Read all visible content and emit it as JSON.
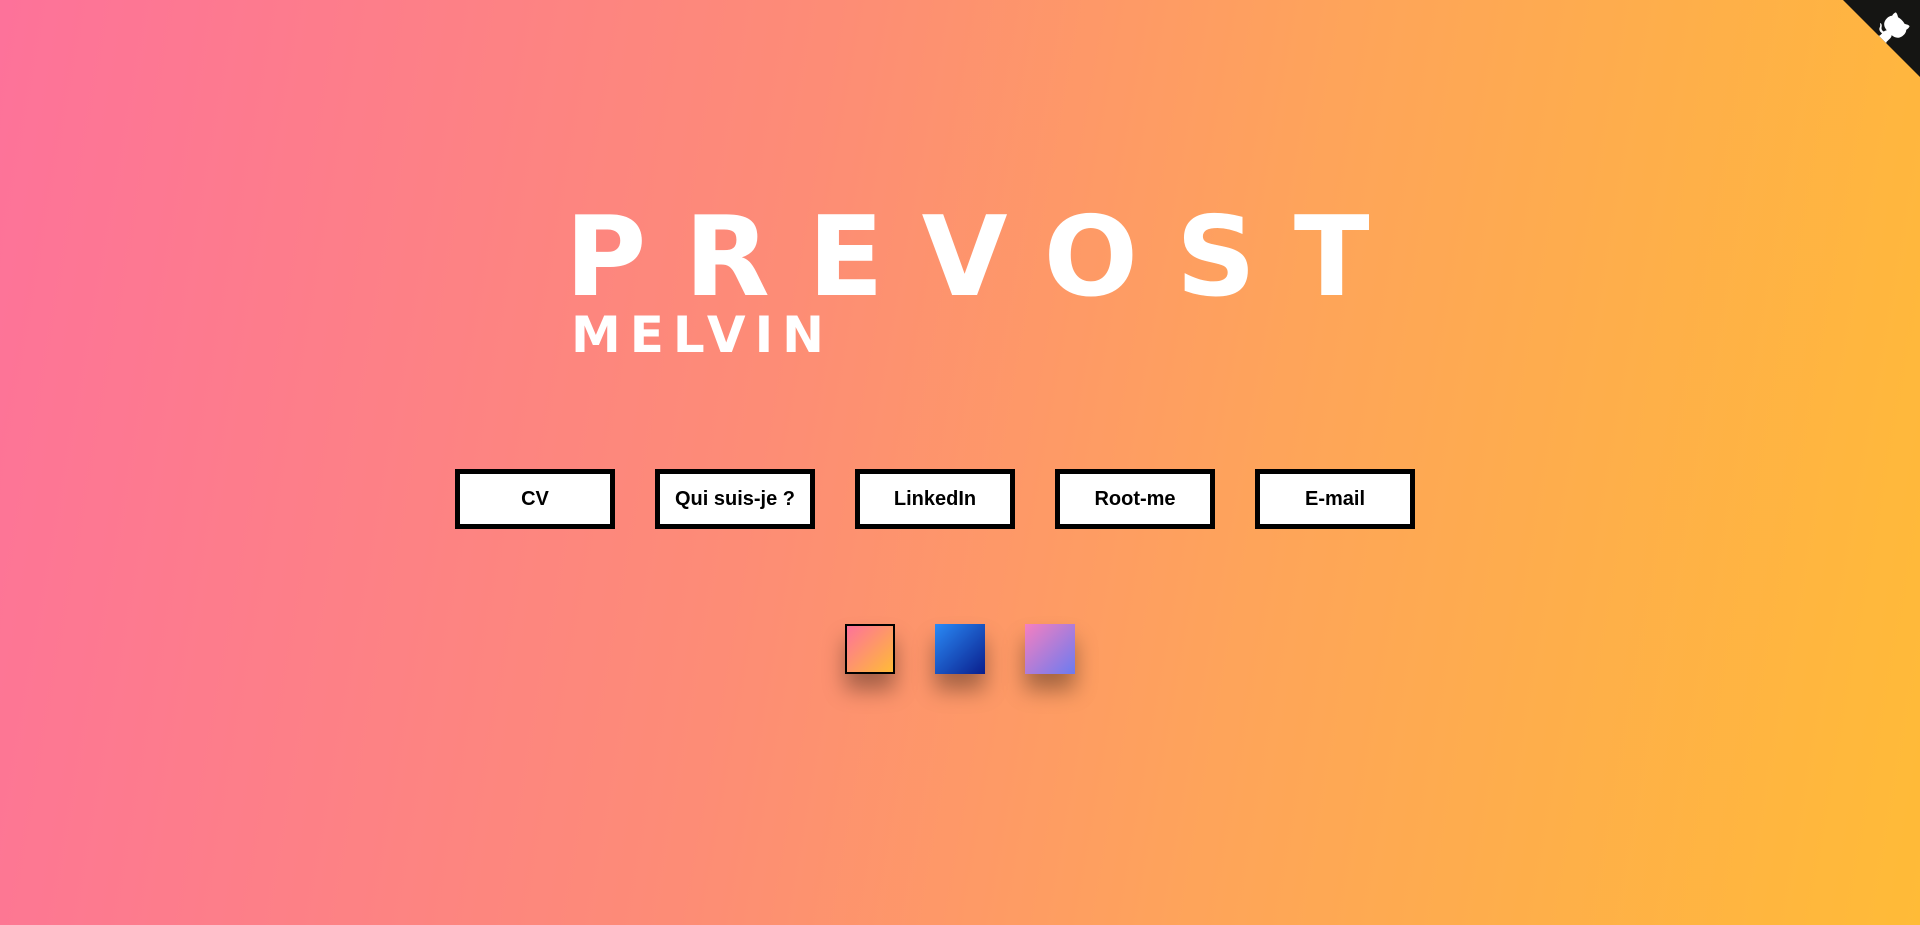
{
  "header": {
    "last_name": "PREVOST",
    "first_name": "MELVIN"
  },
  "nav": {
    "buttons": [
      {
        "label": "CV"
      },
      {
        "label": "Qui suis-je ?"
      },
      {
        "label": "LinkedIn"
      },
      {
        "label": "Root-me"
      },
      {
        "label": "E-mail"
      }
    ]
  },
  "themes": [
    {
      "name": "pink-orange",
      "colors": [
        "#fd729a",
        "#ffbb37"
      ],
      "selected": true
    },
    {
      "name": "blue",
      "colors": [
        "#2a8af6",
        "#0a1e8c"
      ],
      "selected": false
    },
    {
      "name": "pink-purple",
      "colors": [
        "#f57fc0",
        "#6b7bf0"
      ],
      "selected": false
    }
  ],
  "corner": {
    "icon": "github-icon",
    "color": "#151513"
  },
  "background": {
    "colors": [
      "#fd729a",
      "#ffbb37"
    ]
  }
}
